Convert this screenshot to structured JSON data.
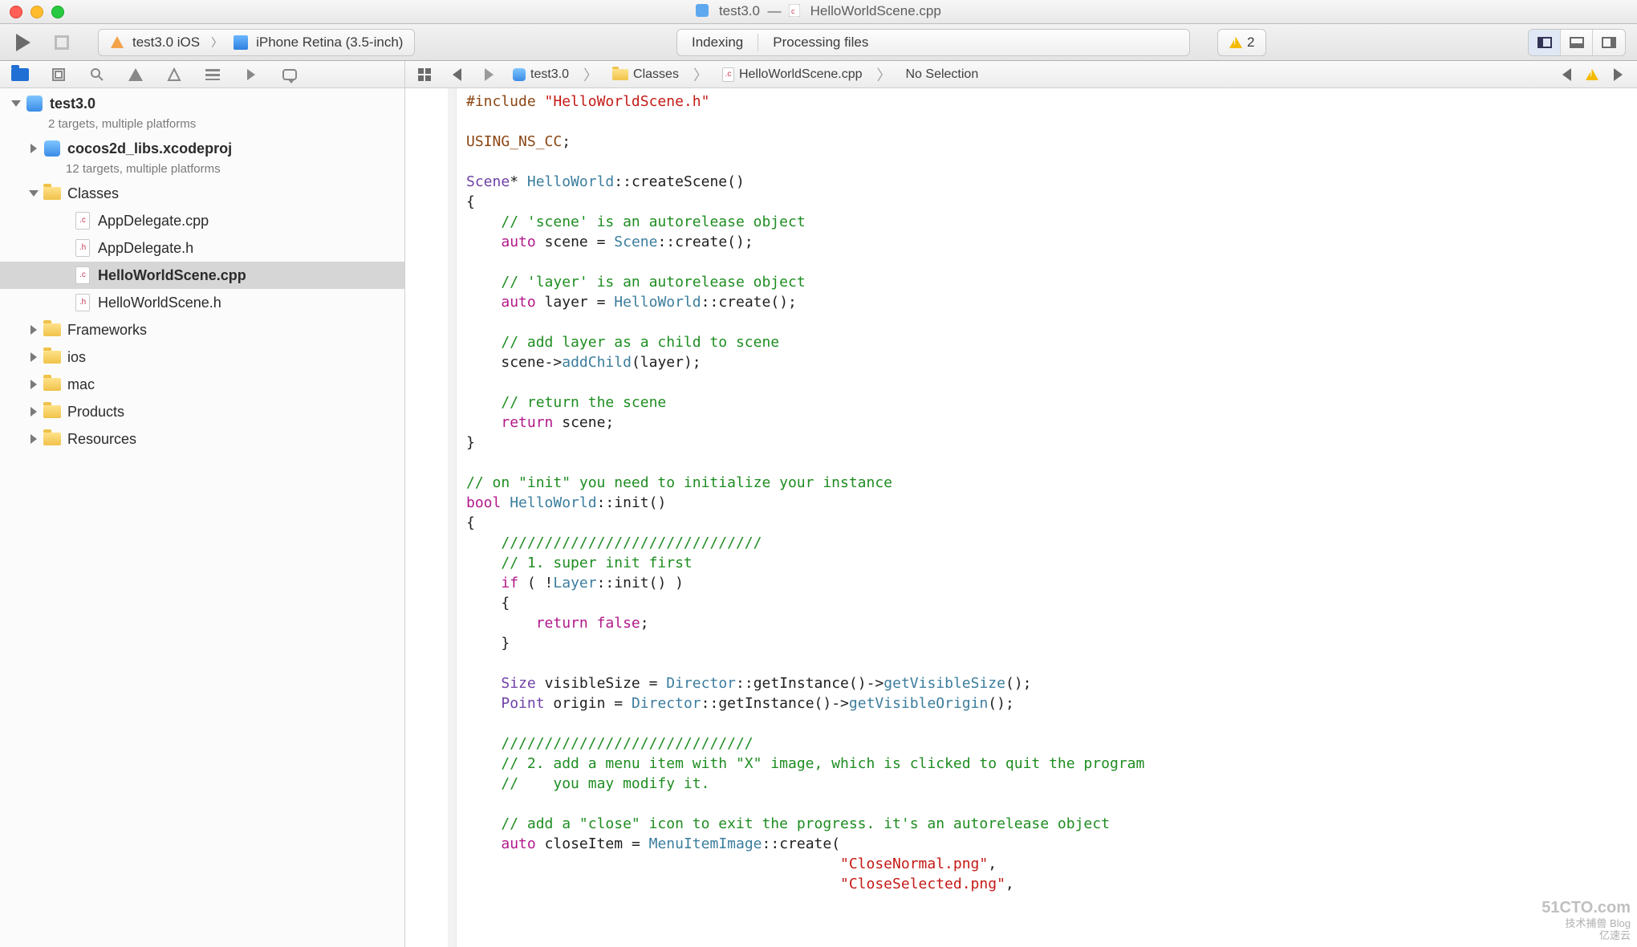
{
  "titlebar": {
    "project_name": "test3.0",
    "sep": "—",
    "file_name": "HelloWorldScene.cpp"
  },
  "toolbar": {
    "scheme_target": "test3.0 iOS",
    "scheme_device": "iPhone Retina (3.5-inch)"
  },
  "activity": {
    "left": "Indexing",
    "right": "Processing files"
  },
  "issues": {
    "warning_count": "2"
  },
  "navigator": {
    "project": {
      "name": "test3.0",
      "subtitle": "2 targets, multiple platforms"
    },
    "subproj": {
      "name": "cocos2d_libs.xcodeproj",
      "subtitle": "12 targets, multiple platforms"
    },
    "groups": {
      "classes": "Classes",
      "frameworks": "Frameworks",
      "ios": "ios",
      "mac": "mac",
      "products": "Products",
      "resources": "Resources"
    },
    "files": {
      "appdelegate_cpp": "AppDelegate.cpp",
      "appdelegate_h": "AppDelegate.h",
      "hw_cpp": "HelloWorldScene.cpp",
      "hw_h": "HelloWorldScene.h"
    }
  },
  "jumpbar": {
    "project": "test3.0",
    "group": "Classes",
    "file": "HelloWorldScene.cpp",
    "selection": "No Selection"
  },
  "code": {
    "include_kw": "#include",
    "include_arg": "\"HelloWorldScene.h\"",
    "using_ns": "USING_NS_CC",
    "t_scene": "Scene",
    "cls_hw": "HelloWorld",
    "fn_createScene": "createScene",
    "kw_auto": "auto",
    "kw_return": "return",
    "kw_if": "if",
    "kw_bool": "bool",
    "kw_false": "false",
    "id_scene": "scene",
    "id_layer": "layer",
    "id_closeItem": "closeItem",
    "id_visibleSize": "visibleSize",
    "id_origin": "origin",
    "fn_create": "create",
    "fn_addChild": "addChild",
    "fn_init": "init",
    "t_layer": "Layer",
    "t_size": "Size",
    "t_point": "Point",
    "t_director": "Director",
    "t_menuitemimage": "MenuItemImage",
    "fn_getInstance": "getInstance",
    "fn_getVisibleSize": "getVisibleSize",
    "fn_getVisibleOrigin": "getVisibleOrigin",
    "str_close_normal": "\"CloseNormal.png\"",
    "str_close_selected": "\"CloseSelected.png\"",
    "c_scene_auto": "// 'scene' is an autorelease object",
    "c_layer_auto": "// 'layer' is an autorelease object",
    "c_add_layer": "// add layer as a child to scene",
    "c_return_scene": "// return the scene",
    "c_on_init": "// on \"init\" you need to initialize your instance",
    "c_slashes": "//////////////////////////////",
    "c_super_init": "// 1. super init first",
    "c_slashes2": "/////////////////////////////",
    "c_menu_item": "// 2. add a menu item with \"X\" image, which is clicked to quit the program",
    "c_modify_it": "//    you may modify it.",
    "c_close_icon": "// add a \"close\" icon to exit the progress. it's an autorelease object"
  },
  "watermark": {
    "top": "51CTO.com",
    "sub1": "技术捕兽  Blog",
    "sub2": "亿速云"
  }
}
